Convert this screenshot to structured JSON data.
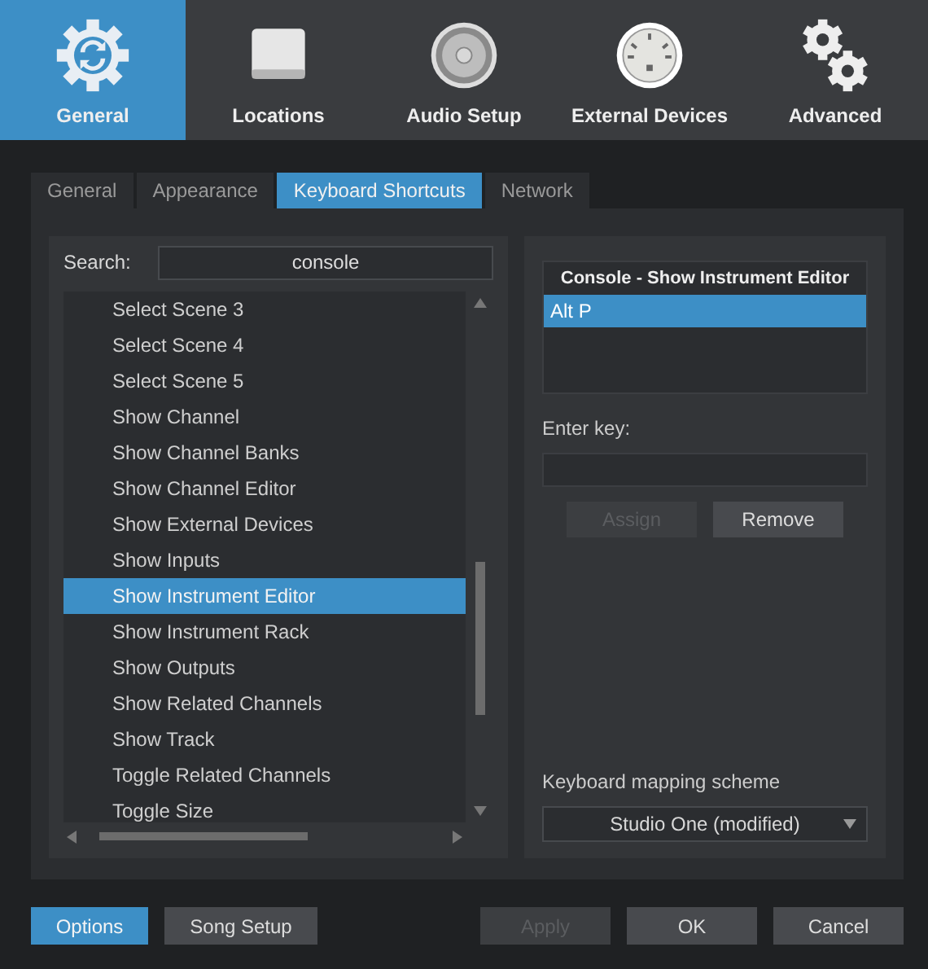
{
  "nav": [
    {
      "label": "General",
      "kind": "sync",
      "selected": true
    },
    {
      "label": "Locations",
      "kind": "drive",
      "selected": false
    },
    {
      "label": "Audio Setup",
      "kind": "speaker",
      "selected": false
    },
    {
      "label": "External Devices",
      "kind": "midi",
      "selected": false
    },
    {
      "label": "Advanced",
      "kind": "gears",
      "selected": false
    }
  ],
  "tabs": [
    {
      "label": "General",
      "selected": false
    },
    {
      "label": "Appearance",
      "selected": false
    },
    {
      "label": "Keyboard Shortcuts",
      "selected": true
    },
    {
      "label": "Network",
      "selected": false
    }
  ],
  "search": {
    "label": "Search:",
    "value": "console"
  },
  "commands": [
    {
      "label": "Select Scene 3",
      "selected": false
    },
    {
      "label": "Select Scene 4",
      "selected": false
    },
    {
      "label": "Select Scene 5",
      "selected": false
    },
    {
      "label": "Show Channel",
      "selected": false
    },
    {
      "label": "Show Channel Banks",
      "selected": false
    },
    {
      "label": "Show Channel Editor",
      "selected": false
    },
    {
      "label": "Show External Devices",
      "selected": false
    },
    {
      "label": "Show Inputs",
      "selected": false
    },
    {
      "label": "Show Instrument Editor",
      "selected": true
    },
    {
      "label": "Show Instrument Rack",
      "selected": false
    },
    {
      "label": "Show Outputs",
      "selected": false
    },
    {
      "label": "Show Related Channels",
      "selected": false
    },
    {
      "label": "Show Track",
      "selected": false
    },
    {
      "label": "Toggle Related Channels",
      "selected": false
    },
    {
      "label": "Toggle Size",
      "selected": false
    }
  ],
  "shortcut_panel": {
    "title": "Console - Show Instrument Editor",
    "shortcuts": [
      {
        "label": "Alt P",
        "selected": true
      }
    ],
    "enter_key_label": "Enter key:",
    "buttons": [
      {
        "label": "Assign",
        "disabled": true
      },
      {
        "label": "Remove",
        "disabled": false
      }
    ],
    "scheme_label": "Keyboard mapping scheme",
    "scheme_value": "Studio One (modified)"
  },
  "footer_left": [
    {
      "label": "Options",
      "kind": "primary"
    },
    {
      "label": "Song Setup",
      "kind": "normal"
    }
  ],
  "footer_right": [
    {
      "label": "Apply",
      "disabled": true
    },
    {
      "label": "OK",
      "disabled": false
    },
    {
      "label": "Cancel",
      "disabled": false
    }
  ]
}
